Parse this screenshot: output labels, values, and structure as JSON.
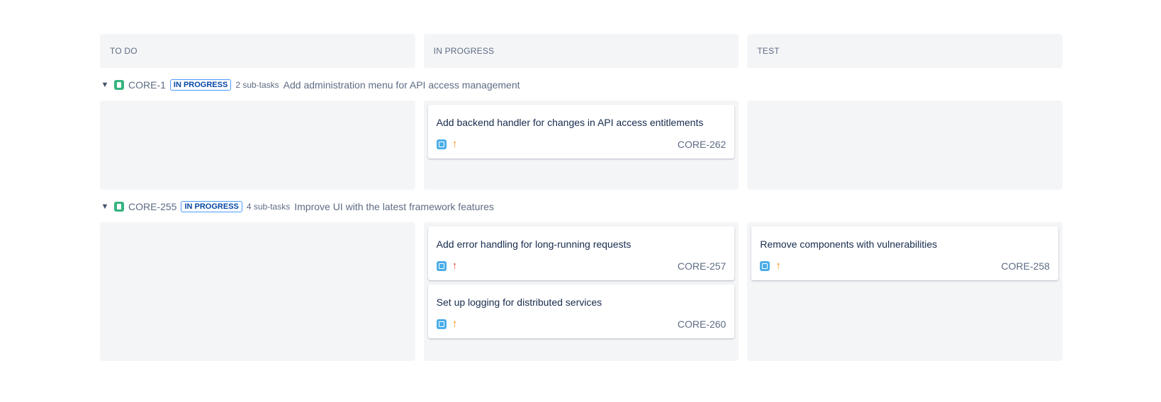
{
  "columns": [
    "TO DO",
    "IN PROGRESS",
    "TEST"
  ],
  "swimlanes": [
    {
      "key": "CORE-1",
      "status": "IN PROGRESS",
      "subtasks": "2 sub-tasks",
      "summary": "Add administration menu for API access management",
      "cards": {
        "in_progress": [
          {
            "title": "Add backend handler for changes in API access entitlements",
            "key": "CORE-262",
            "priority_icon": "arrow-up-icon",
            "priority_color": "#ff8b00"
          }
        ]
      }
    },
    {
      "key": "CORE-255",
      "status": "IN PROGRESS",
      "subtasks": "4 sub-tasks",
      "summary": "Improve UI with the latest framework features",
      "cards": {
        "in_progress": [
          {
            "title": "Add error handling for long-running requests",
            "key": "CORE-257",
            "priority_icon": "arrow-up-icon",
            "priority_color": "#e5493a"
          },
          {
            "title": "Set up logging for distributed services",
            "key": "CORE-260",
            "priority_icon": "arrow-up-icon",
            "priority_color": "#ff8b00"
          }
        ],
        "test": [
          {
            "title": "Remove components with vulnerabilities",
            "key": "CORE-258",
            "priority_icon": "arrow-up-icon",
            "priority_color": "#ff8b00"
          }
        ]
      }
    }
  ],
  "colors": {
    "story": "#36b37e",
    "subtask": "#4bade8",
    "lane_bg": "#f4f5f7",
    "lozenge_border": "#4c9aff"
  }
}
